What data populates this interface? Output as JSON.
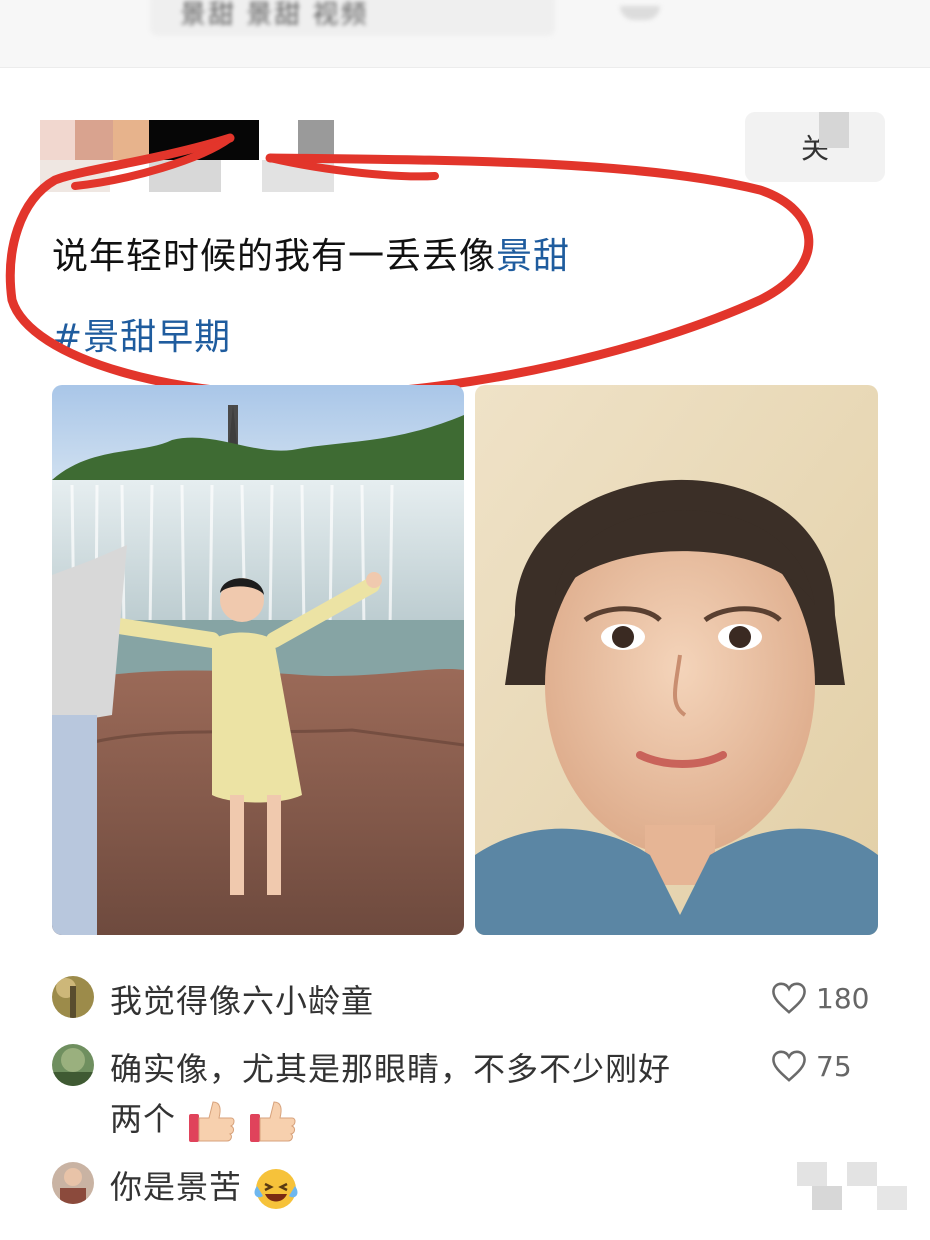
{
  "top_bar": {
    "search_text": "景甜 景甜 视频"
  },
  "post": {
    "follow_label": "关",
    "text_main": "说年轻时候的我有一丢丢像",
    "text_link": "景甜",
    "hashtag": "#景甜早期"
  },
  "images": [
    {
      "alt": "woman in yellow dress in front of waterfall"
    },
    {
      "alt": "close-up portrait of a young woman"
    }
  ],
  "comments": [
    {
      "text": "我觉得像六小龄童",
      "likes": "180"
    },
    {
      "text_line1": "确实像，尤其是那眼睛，不多不少刚好",
      "text_line2": "两个",
      "likes": "75"
    },
    {
      "text": "你是景苦"
    }
  ],
  "colors": {
    "link": "#1f5c9e",
    "annotation_red": "#e2352b",
    "text": "#1c1c1c"
  }
}
